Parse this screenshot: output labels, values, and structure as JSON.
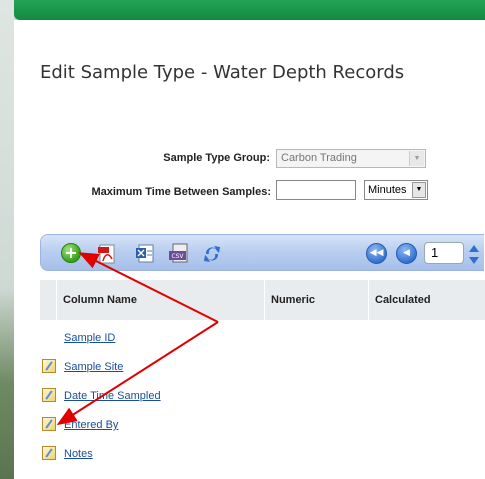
{
  "page": {
    "title": "Edit Sample Type - Water Depth Records"
  },
  "form": {
    "group_label": "Sample Type Group:",
    "group_value": "Carbon Trading",
    "max_time_label": "Maximum Time Between Samples:",
    "max_time_value": "",
    "unit_value": "Minutes"
  },
  "toolbar": {
    "icons": [
      "add-icon",
      "pdf-icon",
      "excel-icon",
      "csv-icon",
      "refresh-icon"
    ],
    "page_value": "1"
  },
  "grid": {
    "columns": [
      "Column Name",
      "Numeric",
      "Calculated"
    ],
    "rows": [
      {
        "name": "Sample ID",
        "editable": false
      },
      {
        "name": "Sample Site",
        "editable": true
      },
      {
        "name": "Date Time Sampled",
        "editable": true
      },
      {
        "name": "Entered By",
        "editable": true
      },
      {
        "name": "Notes",
        "editable": true
      }
    ]
  },
  "colors": {
    "accent_green": "#22a455",
    "annotation_red": "#e00000",
    "link_blue": "#1a4e9a"
  }
}
